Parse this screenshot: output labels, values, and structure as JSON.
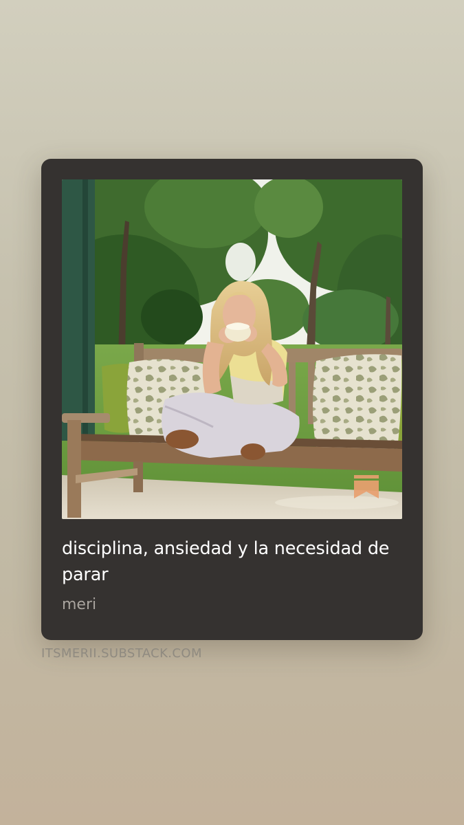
{
  "post": {
    "title": "disciplina, ansiedad y la necesidad de parar",
    "author": "meri",
    "domain": "ITSMERII.SUBSTACK.COM"
  },
  "colors": {
    "card_background": "#353230",
    "title_text": "#ffffff",
    "author_text": "#a9a49e",
    "domain_text": "#8f8a80",
    "bookmark_accent": "#e8a070"
  },
  "icons": {
    "bookmark": "bookmark-icon"
  }
}
